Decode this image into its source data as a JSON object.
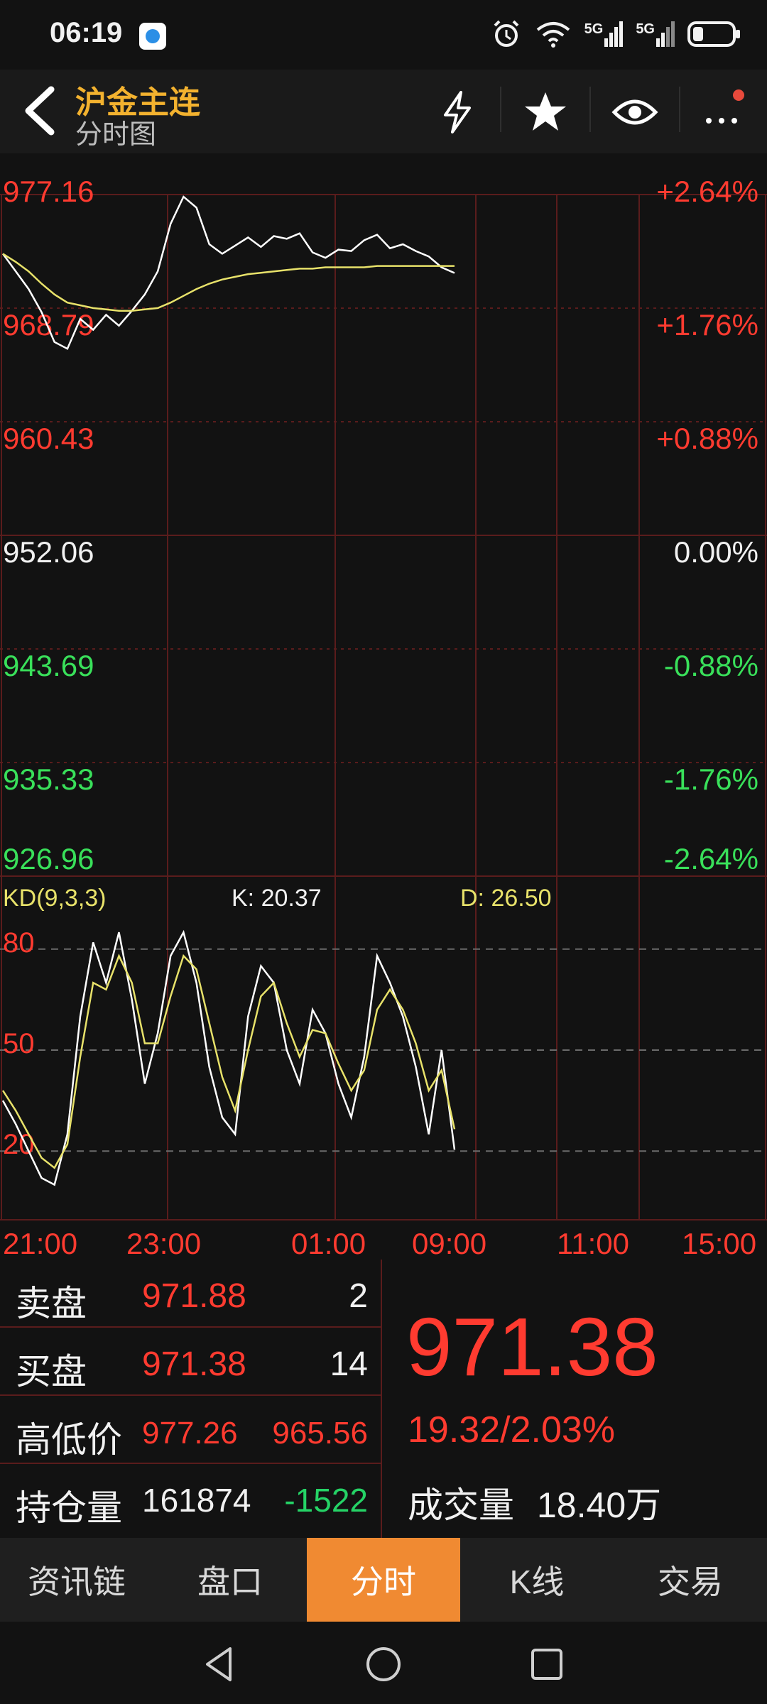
{
  "status_bar": {
    "time": "06:19",
    "icons": [
      "app-icon",
      "alarm-icon",
      "wifi-icon",
      "signal-5g-icon",
      "signal-5g-icon",
      "battery-icon"
    ],
    "network_labels": [
      "5G",
      "5G"
    ]
  },
  "header": {
    "title": "沪金主连",
    "subtitle": "分时图",
    "icons": [
      "flash-icon",
      "star-icon",
      "eye-icon",
      "more-icon"
    ]
  },
  "chart": {
    "price_left_labels": [
      "977.16",
      "968.79",
      "960.43",
      "952.06",
      "943.69",
      "935.33",
      "926.96"
    ],
    "pct_right_labels": [
      "+2.64%",
      "+1.76%",
      "+0.88%",
      "0.00%",
      "-0.88%",
      "-1.76%",
      "-2.64%"
    ],
    "kd": {
      "title": "KD(9,3,3)",
      "k": "K: 20.37",
      "d": "D: 26.50",
      "levels": [
        "80",
        "50",
        "20"
      ]
    },
    "time_labels": [
      "21:00",
      "23:00",
      "01:00",
      "09:00",
      "11:00",
      "15:00"
    ],
    "colors": {
      "price_line": "#ffffff",
      "avg_line": "#e8e26a",
      "grid": "#5a1c1c"
    }
  },
  "chart_data": [
    {
      "type": "line",
      "title": "",
      "x": [
        "21:00",
        "21:10",
        "21:20",
        "21:30",
        "21:40",
        "21:50",
        "22:00",
        "22:10",
        "22:20",
        "22:30",
        "22:40",
        "22:50",
        "23:00",
        "23:10",
        "23:20",
        "23:30",
        "23:40",
        "23:50",
        "00:00",
        "00:10",
        "00:20",
        "00:30",
        "00:40",
        "00:50",
        "01:00",
        "01:10",
        "01:20",
        "01:30",
        "01:40",
        "01:50",
        "02:00",
        "02:10",
        "02:20",
        "02:30",
        "09:00",
        "09:05"
      ],
      "series": [
        {
          "values": [
            972.8,
            971.5,
            970.2,
            968.5,
            966.3,
            965.8,
            968.0,
            967.2,
            968.3,
            967.5,
            968.6,
            969.8,
            971.5,
            975.0,
            977.0,
            976.2,
            973.5,
            972.8,
            973.4,
            974.0,
            973.3,
            974.1,
            973.9,
            974.3,
            972.9,
            972.5,
            973.1,
            973.0,
            973.8,
            974.2,
            973.2,
            973.5,
            973.0,
            972.6,
            971.8,
            971.38
          ]
        },
        {
          "values": [
            972.8,
            972.2,
            971.5,
            970.6,
            969.8,
            969.2,
            969.0,
            968.8,
            968.7,
            968.6,
            968.6,
            968.7,
            968.8,
            969.2,
            969.7,
            970.2,
            970.6,
            970.9,
            971.1,
            971.3,
            971.4,
            971.5,
            971.6,
            971.7,
            971.7,
            971.8,
            971.8,
            971.8,
            971.8,
            971.9,
            971.9,
            971.9,
            971.9,
            971.9,
            971.9,
            971.9
          ]
        }
      ],
      "ylim": [
        926.96,
        977.16
      ]
    },
    {
      "type": "line",
      "title": "KD(9,3,3)",
      "series": [
        {
          "name": "K",
          "values": [
            35,
            28,
            20,
            12,
            10,
            25,
            60,
            82,
            70,
            85,
            65,
            40,
            55,
            78,
            85,
            70,
            45,
            30,
            25,
            60,
            75,
            70,
            50,
            40,
            62,
            55,
            40,
            30,
            48,
            78,
            70,
            60,
            45,
            25,
            50,
            20.37
          ]
        },
        {
          "name": "D",
          "values": [
            38,
            32,
            25,
            18,
            15,
            22,
            48,
            70,
            68,
            78,
            70,
            52,
            52,
            66,
            78,
            74,
            58,
            42,
            32,
            50,
            66,
            70,
            58,
            48,
            56,
            55,
            46,
            38,
            44,
            62,
            68,
            62,
            52,
            38,
            44,
            26.5
          ]
        }
      ],
      "ylim": [
        0,
        100
      ]
    }
  ],
  "panel": {
    "sell": {
      "label": "卖盘",
      "price": "971.88",
      "qty": "2"
    },
    "buy": {
      "label": "买盘",
      "price": "971.38",
      "qty": "14"
    },
    "highlow": {
      "label": "高低价",
      "high": "977.26",
      "low": "965.56"
    },
    "oi": {
      "label": "持仓量",
      "value": "161874",
      "change": "-1522"
    },
    "last_price": "971.38",
    "change": "19.32/2.03%",
    "volume_label": "成交量",
    "volume": "18.40万"
  },
  "tabs": [
    {
      "label": "资讯链",
      "active": false
    },
    {
      "label": "盘口",
      "active": false
    },
    {
      "label": "分时",
      "active": true
    },
    {
      "label": "K线",
      "active": false
    },
    {
      "label": "交易",
      "active": false
    }
  ],
  "nav": [
    "back-nav-icon",
    "home-nav-icon",
    "recents-nav-icon"
  ]
}
